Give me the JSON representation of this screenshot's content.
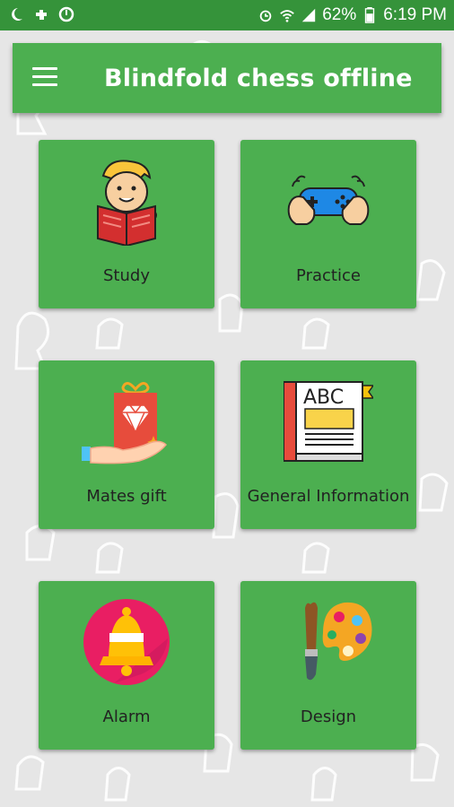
{
  "status_bar": {
    "battery": "62%",
    "time": "6:19 PM"
  },
  "app_bar": {
    "title": "Blindfold chess offline"
  },
  "tiles": [
    {
      "label": "Study",
      "icon": "reading-boy-icon"
    },
    {
      "label": "Practice",
      "icon": "gamepad-icon"
    },
    {
      "label": "Mates gift",
      "icon": "gift-diamond-icon"
    },
    {
      "label": "General Information",
      "icon": "abc-book-icon"
    },
    {
      "label": "Alarm",
      "icon": "bell-icon"
    },
    {
      "label": "Design",
      "icon": "palette-icon"
    }
  ],
  "colors": {
    "status_bar": "#35933a",
    "app_bar": "#4caf50",
    "tile": "#4caf50",
    "background": "#e6e6e6"
  }
}
